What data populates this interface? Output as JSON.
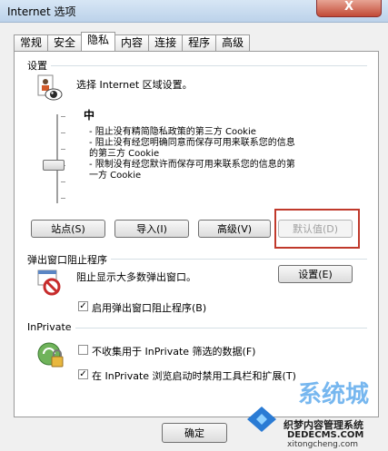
{
  "window": {
    "title": "Internet 选项",
    "close_glyph": "X"
  },
  "tabs": [
    {
      "label": "常规"
    },
    {
      "label": "安全"
    },
    {
      "label": "隐私"
    },
    {
      "label": "内容"
    },
    {
      "label": "连接"
    },
    {
      "label": "程序"
    },
    {
      "label": "高级"
    }
  ],
  "settings": {
    "group_label": "设置",
    "intro": "选择 Internet 区域设置。",
    "level": "中",
    "desc_lines": [
      "- 阻止没有精简隐私政策的第三方 Cookie",
      "- 阻止没有经您明确同意而保存可用来联系您的信息",
      "的第三方 Cookie",
      "- 限制没有经您默许而保存可用来联系您的信息的第",
      "一方 Cookie"
    ],
    "buttons": {
      "sites": "站点(S)",
      "import": "导入(I)",
      "advanced": "高级(V)",
      "default": "默认值(D)"
    }
  },
  "popup": {
    "group_label": "弹出窗口阻止程序",
    "desc": "阻止显示大多数弹出窗口。",
    "settings_button": "设置(E)",
    "enable_label": "启用弹出窗口阻止程序(B)",
    "enable_checked": true
  },
  "inprivate": {
    "group_label": "InPrivate",
    "opt1_label": "不收集用于 InPrivate 筛选的数据(F)",
    "opt1_checked": false,
    "opt2_label": "在 InPrivate 浏览启动时禁用工具栏和扩展(T)",
    "opt2_checked": true
  },
  "footer": {
    "ok": "确定"
  },
  "watermark": {
    "line1": "系统城",
    "line2": "织梦内容管理系统",
    "line3": "DEDECMS.COM",
    "line4": "xitongcheng.com"
  }
}
